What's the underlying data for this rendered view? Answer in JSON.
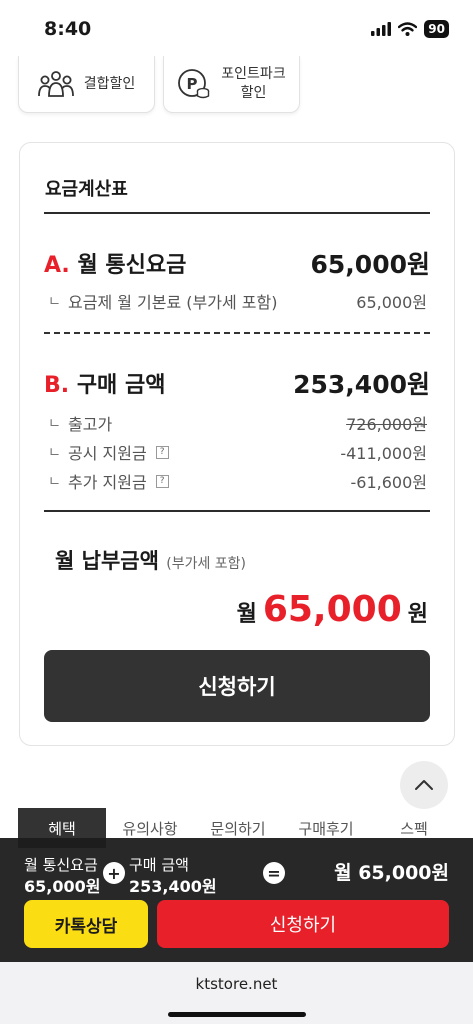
{
  "status": {
    "time": "8:40",
    "battery": "90"
  },
  "discounts": [
    {
      "label": "결합할인",
      "icon": "people-icon"
    },
    {
      "label_line1": "포인트파크",
      "label_line2": "할인",
      "icon": "point-icon"
    }
  ],
  "calc": {
    "title": "요금계산표",
    "section_a": {
      "letter": "A.",
      "name": "월 통신요금",
      "amount": "65,000원",
      "items": [
        {
          "label": "요금제 월 기본료 (부가세 포함)",
          "value": "65,000원"
        }
      ]
    },
    "section_b": {
      "letter": "B.",
      "name": "구매 금액",
      "amount": "253,400원",
      "items": [
        {
          "label": "출고가",
          "value": "726,000원"
        },
        {
          "label": "공시 지원금",
          "value": "-411,000원"
        },
        {
          "label": "추가 지원금",
          "value": "-61,600원"
        }
      ]
    },
    "branch": "ㄴ",
    "help": "?",
    "monthly": {
      "title": "월 납부금액",
      "vat": "(부가세 포함)",
      "prefix": "월",
      "amount": "65,000",
      "suffix": "원"
    },
    "apply_label": "신청하기"
  },
  "tabs": [
    "혜택",
    "유의사항",
    "문의하기",
    "구매후기",
    "스펙"
  ],
  "bottom": {
    "monthly_label": "월 통신요금",
    "monthly_value": "65,000원",
    "plus": "+",
    "purchase_label": "구매 금액",
    "purchase_value": "253,400원",
    "equals": "=",
    "total": "월 65,000원",
    "kakao_label": "카톡상담",
    "apply_label": "신청하기"
  },
  "browser": {
    "url": "ktstore.net"
  },
  "colors": {
    "accent": "#e8202a",
    "kakao": "#fbdd13",
    "dark": "#333333"
  }
}
